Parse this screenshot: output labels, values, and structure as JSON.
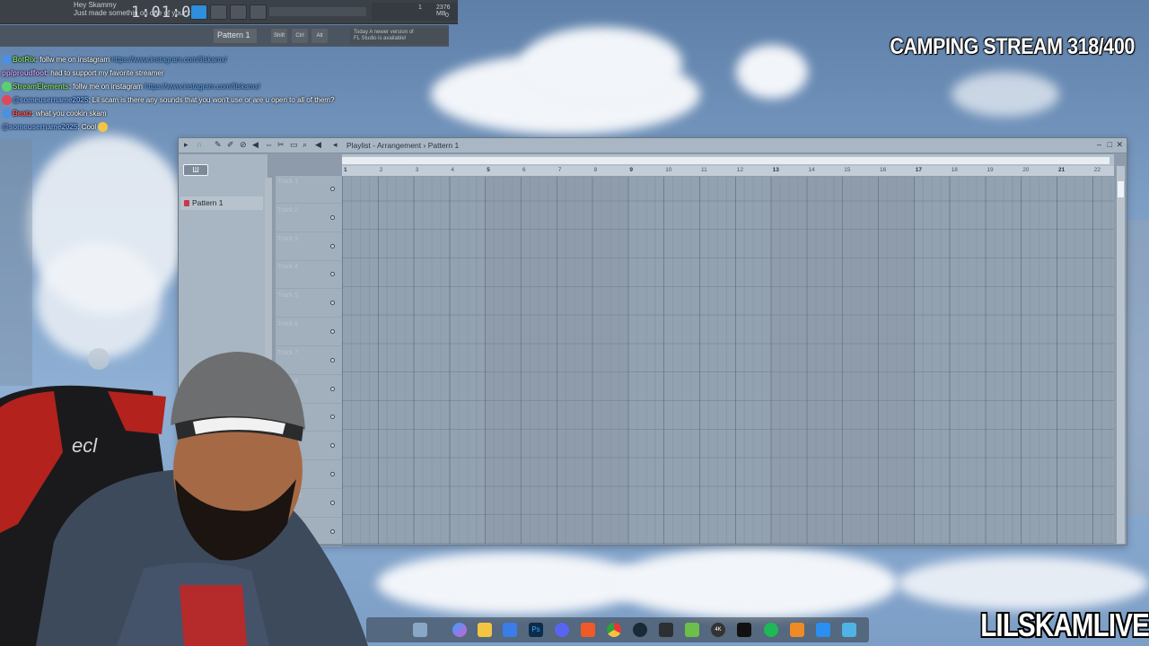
{
  "overlay": {
    "stream_title": "CAMPING STREAM 318/400",
    "channel_name": "LILSKAMLIVE"
  },
  "fl_studio": {
    "song_position": "1:01:00",
    "hint_line_1": "Hey Skammy",
    "hint_line_2": "Just made somethin on one of your beats",
    "cpu_value": "1",
    "ram_value": "2376 MB",
    "poly_value": "0",
    "pattern_selector": "Pattern 1",
    "update_notice_line1": "Today  A newer version of",
    "update_notice_line2": "FL Studio is available!",
    "small_buttons": [
      "Shift",
      "Ctrl",
      "Alt"
    ]
  },
  "chat": {
    "messages": [
      {
        "user": "BotRix",
        "text": ": follw me on instagram ",
        "link": "https://www.instagram.com/lilskamx/",
        "user_color": "#7cd86b"
      },
      {
        "user": "pp/proudfoot",
        "text": ": had to support my favorite streamer",
        "link": "",
        "user_color": "#c9a2ff"
      },
      {
        "user": "StreamElements",
        "text": ": follw me on instagram ",
        "link": "https://www.instagram.com/lilskamx/",
        "user_color": "#7cd86b"
      },
      {
        "user": "@someusername2025",
        "text": ": Lil scam is there any sounds that you won't use or are u open to all of them?",
        "link": "",
        "user_color": "#6fa9ff"
      },
      {
        "user": "Beatz",
        "text": ": what you cookin skam",
        "link": "",
        "user_color": "#ff5a5a"
      },
      {
        "user": "@someusername2025",
        "text": ": Cool",
        "link": "",
        "user_color": "#6fa9ff"
      }
    ]
  },
  "playlist": {
    "window_title": "Playlist - Arrangement › Pattern 1",
    "patterns": [
      "Pattern 1"
    ],
    "tracks": [
      "Track 1",
      "Track 2",
      "Track 3",
      "Track 4",
      "Track 5",
      "Track 6",
      "Track 7",
      "Track 8",
      "Track 9",
      "Track 10",
      "Track 11",
      "Track 12",
      "Track 13"
    ],
    "bar_numbers": [
      "1",
      "2",
      "3",
      "4",
      "5",
      "6",
      "7",
      "8",
      "9",
      "10",
      "11",
      "12",
      "13",
      "14",
      "15",
      "16",
      "17",
      "18",
      "19",
      "20",
      "21",
      "22"
    ]
  },
  "taskbar": {
    "icons": [
      "weather-icon",
      "copilot-icon",
      "folder-icon",
      "store-icon",
      "photoshop-icon",
      "discord-icon",
      "brave-icon",
      "chrome-icon",
      "steam-icon",
      "app-icon",
      "4k-icon",
      "capcut-icon",
      "spotify-icon",
      "fl-studio-icon",
      "mail-icon",
      "notepad-icon"
    ]
  }
}
